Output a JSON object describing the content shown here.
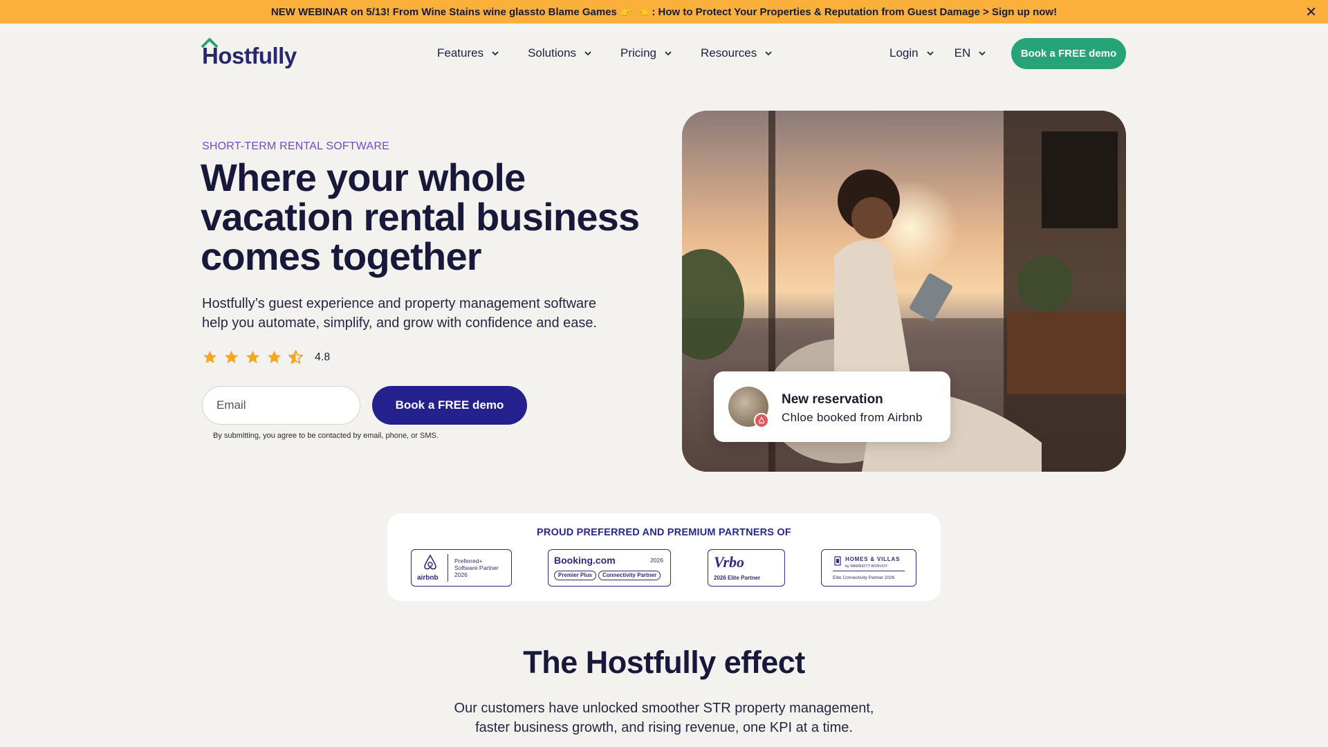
{
  "banner": {
    "text_before": "NEW WEBINAR on 5/13! From Wine Stains wine glassto Blame Games",
    "emoji": "👉 👈",
    "text_after": ": How to Protect Your Properties & Reputation from Guest Damage > Sign up now!",
    "close_icon": "close-icon",
    "background": "#fbb03b"
  },
  "header": {
    "logo_text": "Hostfully",
    "nav": [
      {
        "label": "Features"
      },
      {
        "label": "Solutions"
      },
      {
        "label": "Pricing"
      },
      {
        "label": "Resources"
      }
    ],
    "login_label": "Login",
    "language_label": "EN",
    "cta_label": "Book a FREE demo",
    "cta_color": "#27a37a"
  },
  "hero": {
    "eyebrow": "SHORT-TERM RENTAL SOFTWARE",
    "headline_lines": [
      "Where your whole",
      "vacation rental business",
      "comes together"
    ],
    "subhead_lines": [
      "Hostfully’s guest experience and property management software",
      "help you automate, simplify, and grow with confidence and ease."
    ],
    "rating": {
      "value": "4.8",
      "stars": 4.5,
      "star_color": "#f5a623"
    },
    "email_placeholder": "Email",
    "cta_label": "Book a FREE demo",
    "cta_color": "#24208e",
    "disclaimer": "By submitting, you agree to be contacted by email, phone, or SMS."
  },
  "notification": {
    "title": "New reservation",
    "subtitle": "Chloe booked from Airbnb",
    "badge_icon": "airbnb-icon"
  },
  "partners": {
    "title": "PROUD PREFERRED AND PREMIUM PARTNERS OF",
    "airbnb": {
      "brand": "airbnb",
      "line1": "Preferred+",
      "line2": "Software Partner",
      "line3": "2026"
    },
    "booking": {
      "brand": "Booking.com",
      "year": "2026",
      "pill1": "Premier Plus",
      "pill2": "Connectivity Partner"
    },
    "vrbo": {
      "brand": "Vrbo",
      "line": "2026 Elite Partner"
    },
    "homes_villas": {
      "brand": "HOMES & VILLAS",
      "by": "by MARRIOTT BONVOY",
      "line": "Elite Connectivity Partner 2026"
    }
  },
  "effect": {
    "title": "The Hostfully effect",
    "sub_lines": [
      "Our customers have unlocked smoother STR property management,",
      "faster business growth, and rising revenue, one KPI at a time."
    ]
  }
}
